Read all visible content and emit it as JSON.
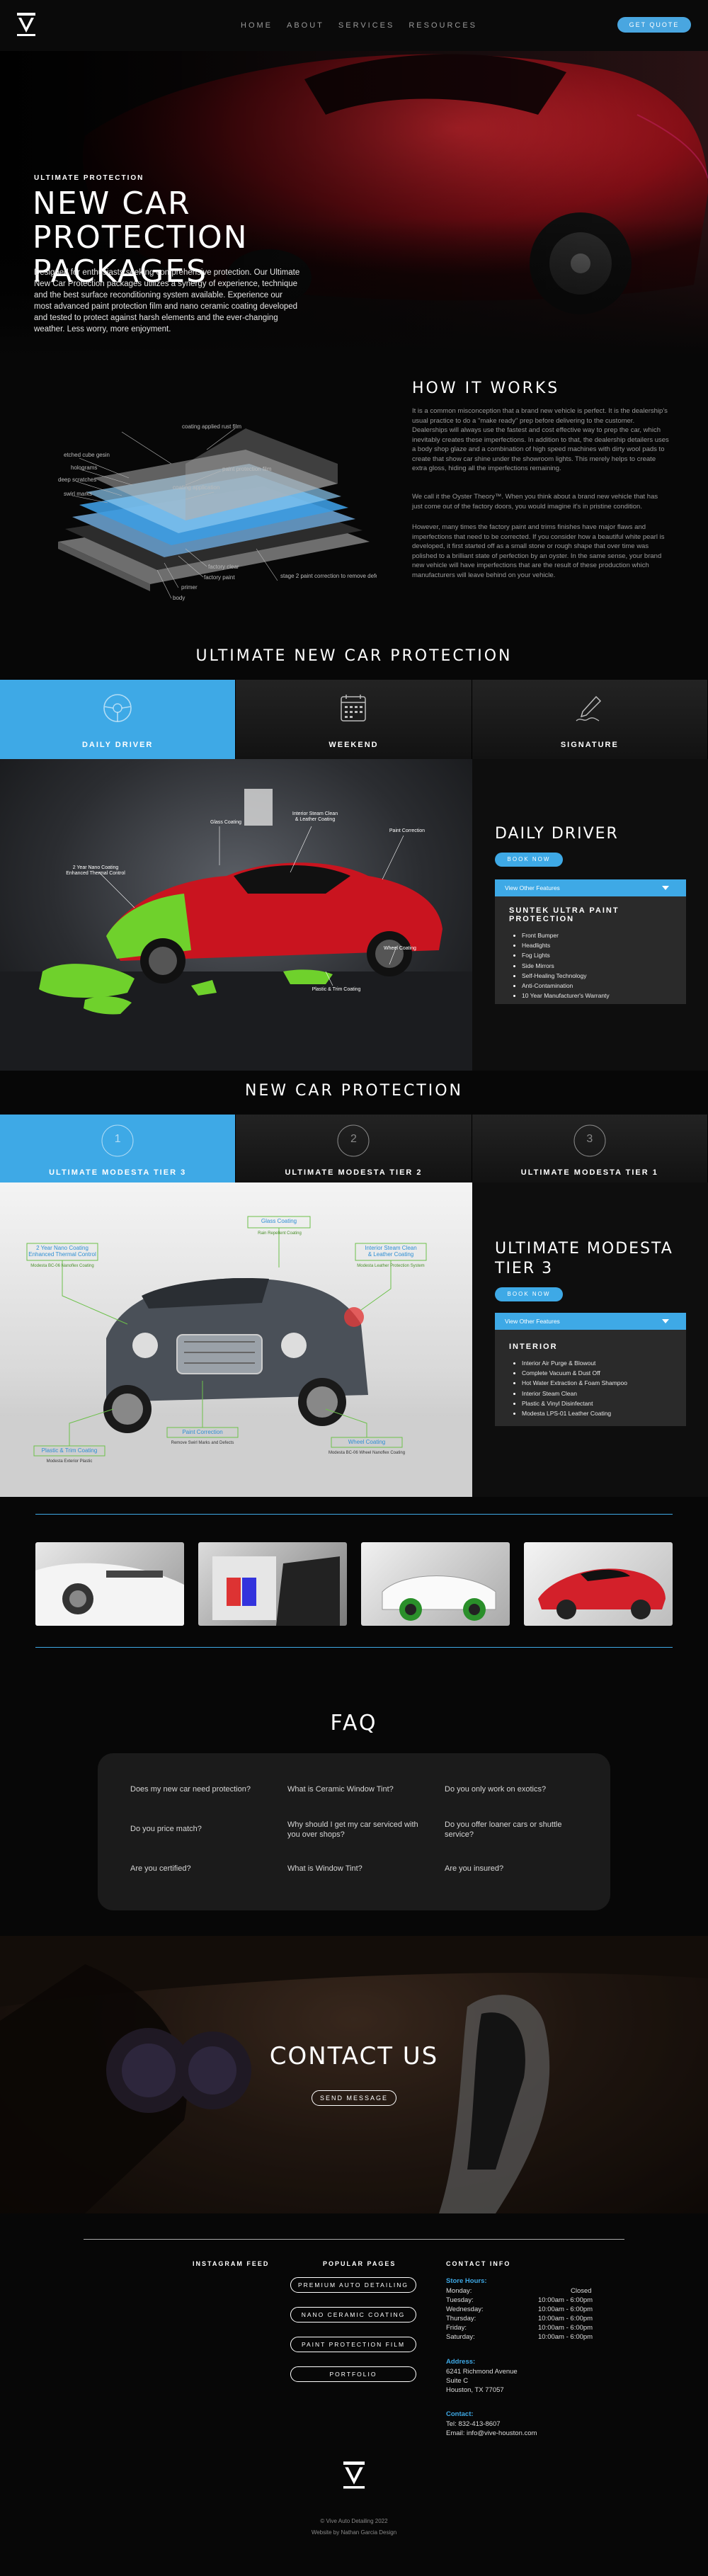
{
  "nav": {
    "links": [
      "HOME",
      "ABOUT",
      "SERVICES",
      "RESOURCES"
    ],
    "cta": "GET QUOTE"
  },
  "hero": {
    "eyebrow": "ULTIMATE PROTECTION",
    "title": "NEW CAR PROTECTION PACKAGES",
    "text": "Designed for enthusiasts seeking comprehensive protection. Our Ultimate New Car Protection packages utilizes a synergy of experience, technique and the best surface reconditioning system available. Experience our most advanced paint protection film and nano ceramic coating developed and tested to protect against harsh elements and the ever-changing weather. Less worry, more enjoyment."
  },
  "how": {
    "title": "HOW IT WORKS",
    "p1": "It is a common misconception that a brand new vehicle is perfect. It is the dealership's usual practice to do a \"make ready\" prep before delivering to the customer. Dealerships will always use the fastest and cost effective way to prep the car, which inevitably creates these imperfections. In addition to that, the dealership detailers uses a body shop glaze and a combination of high speed machines with dirty wool pads to create that show car shine under the showroom lights. This merely helps to create extra gloss, hiding all the imperfections remaining.",
    "p2": "We call it the Oyster Theory™. When you think about a brand new vehicle that has just come out of the factory doors, you would imagine it's in pristine condition.",
    "p3": "However, many times the factory paint and trims finishes have major flaws and imperfections that need to be corrected. If you consider how a beautiful white pearl is developed, it first started off as a small stone or rough shape that over time was polished to a brilliant state of perfection by an oyster. In the same sense, your brand new vehicle will have imperfections that are the result of these production which manufacturers will leave behind on your vehicle.",
    "diagram_labels": {
      "coating_rust": "coating applied rust film",
      "etched": "etched cube gesin",
      "holograms": "holograms",
      "deep_scratches": "deep scratches",
      "swirl_marks": "swirl marks",
      "paint_protection": "paint protection film",
      "coating_application": "coating application",
      "clear_coat": "factory clear",
      "factory_paint": "factory paint",
      "primer": "primer",
      "body": "body",
      "stage2": "stage 2 paint correction to remove defects"
    }
  },
  "ultimate": {
    "title": "ULTIMATE NEW CAR PROTECTION",
    "tabs": [
      "DAILY DRIVER",
      "WEEKEND",
      "SIGNATURE"
    ],
    "image_labels": {
      "ceramic": "2 Year Nano Coating\nEnhanced Thermal Control",
      "glass": "Glass Coating",
      "interior": "Interior Steam Clean\n& Leather Coating",
      "paint": "Paint Correction",
      "wheel": "Wheel Coating",
      "plastic": "Plastic & Trim Coating"
    },
    "side": {
      "title": "DAILY DRIVER",
      "button": "BOOK NOW",
      "features_bar": "View Other Features",
      "features_heading": "SUNTEK ULTRA PAINT PROTECTION",
      "features": [
        "Front Bumper",
        "Headlights",
        "Fog Lights",
        "Side Mirrors",
        "Self-Healing Technology",
        "Anti-Contamination",
        "10 Year Manufacturer's Warranty"
      ]
    }
  },
  "ncp": {
    "title": "NEW CAR PROTECTION",
    "tabs": [
      {
        "num": "1",
        "label": "ULTIMATE MODESTA TIER 3"
      },
      {
        "num": "2",
        "label": "ULTIMATE MODESTA TIER 2"
      },
      {
        "num": "3",
        "label": "ULTIMATE MODESTA TIER 1"
      }
    ],
    "image_labels": {
      "nano": "2 Year Nano Coating\nEnhanced Thermal Control",
      "nano_sub": "Modesta BC-06 Nanoflex Coating",
      "glass": "Glass Coating",
      "glass_sub": "Rain Repellent Coating",
      "interior": "Interior Steam Clean\n& Leather Coating",
      "interior_sub": "Modesta Leather Protection System",
      "paint": "Paint Correction",
      "paint_sub": "Remove Swirl Marks and Defects",
      "plastic": "Plastic & Trim Coating",
      "plastic_sub": "Modesta Exterior Plastic",
      "wheel": "Wheel Coating",
      "wheel_sub": "Modesta BC-06 Wheel Nanoflex Coating"
    },
    "side": {
      "title": "ULTIMATE MODESTA TIER 3",
      "button": "BOOK NOW",
      "features_bar": "View Other Features",
      "features_heading": "INTERIOR",
      "features": [
        "Interior Air Purge & Blowout",
        "Complete Vacuum & Dust Off",
        "Hot Water Extraction & Foam Shampoo",
        "Interior Steam Clean",
        "Plastic & Vinyl Disinfectant",
        "Modesta LPS-01 Leather Coating"
      ]
    }
  },
  "faq": {
    "title": "FAQ",
    "questions": [
      "Does my new car need protection?",
      "What is Ceramic Window Tint?",
      "Do you only work on exotics?",
      "Do you price match?",
      "Why should I get my car serviced with you over shops?",
      "Do you offer loaner cars or shuttle service?",
      "Are you certified?",
      "What is Window Tint?",
      "Are you insured?"
    ]
  },
  "contact": {
    "title": "CONTACT US",
    "button": "SEND MESSAGE"
  },
  "footer": {
    "instagram_heading": "INSTAGRAM FEED",
    "popular_heading": "POPULAR PAGES",
    "contact_heading": "CONTACT INFO",
    "popular_pages": [
      "PREMIUM AUTO DETAILING",
      "NANO CERAMIC COATING",
      "PAINT PROTECTION FILM",
      "PORTFOLIO"
    ],
    "hours_label": "Store Hours:",
    "hours": [
      {
        "day": "Monday:",
        "time": "Closed"
      },
      {
        "day": "Tuesday:",
        "time": "10:00am - 6:00pm"
      },
      {
        "day": "Wednesday:",
        "time": "10:00am - 6:00pm"
      },
      {
        "day": "Thursday:",
        "time": "10:00am - 6:00pm"
      },
      {
        "day": "Friday:",
        "time": "10:00am - 6:00pm"
      },
      {
        "day": "Saturday:",
        "time": "10:00am - 6:00pm"
      }
    ],
    "address_label": "Address:",
    "address": [
      "6241 Richmond Avenue",
      "Suite C",
      "Houston, TX 77057"
    ],
    "contact_label": "Contact:",
    "tel": "Tel: 832-413-8607",
    "email": "Email: info@vive-houston.com",
    "copyright": "© Vive Auto Detailing 2022",
    "credit": "Website by Nathan Garcia Design"
  },
  "colors": {
    "accent": "#3ea9e6",
    "background": "#070707",
    "panel": "#2a2a2a"
  }
}
